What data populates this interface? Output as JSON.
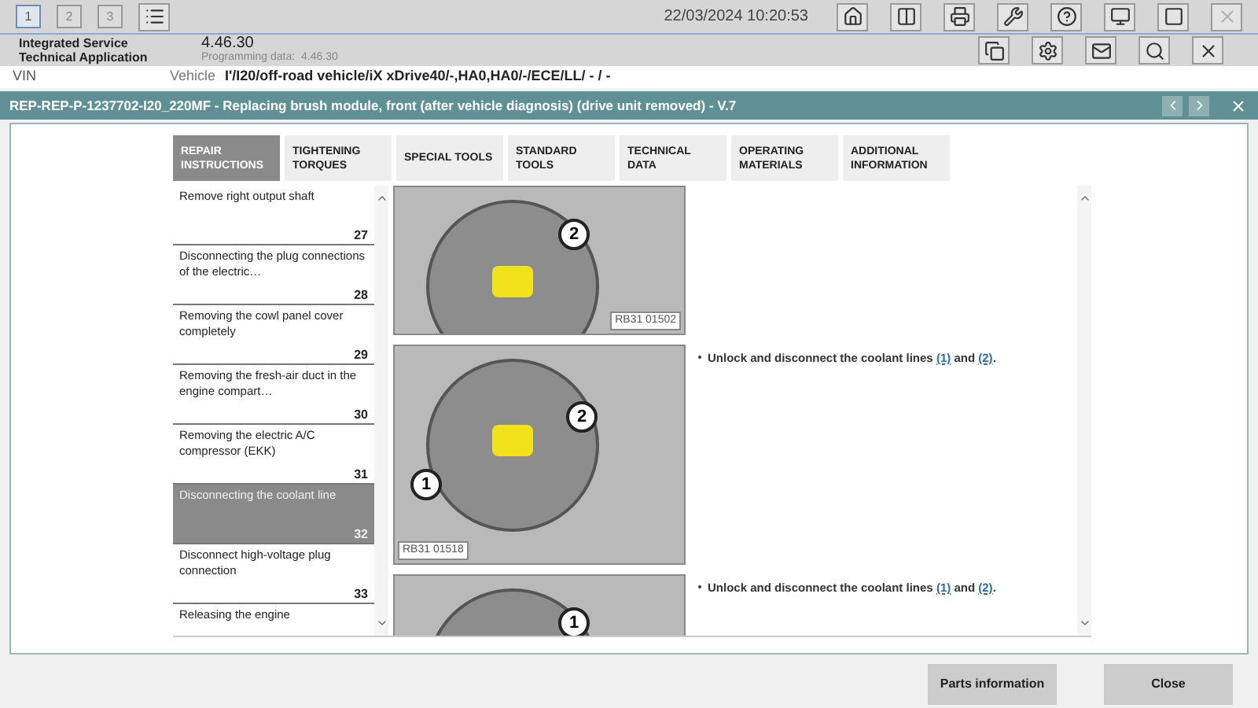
{
  "top_bar": {
    "workspaces": [
      {
        "label": "1",
        "selected": true
      },
      {
        "label": "2",
        "selected": false
      },
      {
        "label": "3",
        "selected": false
      }
    ],
    "datetime": "22/03/2024 10:20:53"
  },
  "app": {
    "name": "Integrated Service Technical Application",
    "version": "4.46.30",
    "programming_label": "Programming data:",
    "programming_value": "4.46.30"
  },
  "vehicle_bar": {
    "vin_label": "VIN",
    "vehicle_label": "Vehicle",
    "vehicle_value": "I'/I20/off-road vehicle/iX xDrive40/-,HA0,HA0/-/ECE/LL/ - / -"
  },
  "document": {
    "title": "REP-REP-P-1237702-I20_220MF - Replacing brush module, front (after vehicle diagnosis) (drive unit removed) - V.7"
  },
  "tabs": [
    {
      "label": "REPAIR INSTRUCTIONS",
      "selected": true
    },
    {
      "label": "TIGHTENING TORQUES",
      "selected": false
    },
    {
      "label": "SPECIAL TOOLS",
      "selected": false
    },
    {
      "label": "STANDARD TOOLS",
      "selected": false
    },
    {
      "label": "TECHNICAL DATA",
      "selected": false
    },
    {
      "label": "OPERATING MATERIALS",
      "selected": false
    },
    {
      "label": "ADDITIONAL INFORMATION",
      "selected": false
    }
  ],
  "steps_list": [
    {
      "title": "Remove right output shaft",
      "number": "27",
      "selected": false
    },
    {
      "title": "Disconnecting the plug connections of the electric…",
      "number": "28",
      "selected": false
    },
    {
      "title": "Removing the cowl panel cover completely",
      "number": "29",
      "selected": false
    },
    {
      "title": "Removing the fresh-air duct in the engine compart…",
      "number": "30",
      "selected": false
    },
    {
      "title": "Removing the electric A/C compressor (EKK)",
      "number": "31",
      "selected": false
    },
    {
      "title": "Disconnecting the coolant line",
      "number": "32",
      "selected": true
    },
    {
      "title": "Disconnect high-voltage plug connection",
      "number": "33",
      "selected": false
    },
    {
      "title": "Releasing the engine",
      "selected": false
    }
  ],
  "figures": [
    {
      "callouts": [
        "2"
      ],
      "code": "RB31 01502"
    },
    {
      "callouts": [
        "1",
        "2"
      ],
      "code": "RB31 01518",
      "segments": [
        {
          "kind": "text",
          "text": "Unlock and disconnect the coolant lines "
        },
        {
          "kind": "link",
          "text": "(1)"
        },
        {
          "kind": "text",
          "text": " and "
        },
        {
          "kind": "link",
          "text": "(2)"
        },
        {
          "kind": "text",
          "text": "."
        }
      ]
    },
    {
      "callouts": [
        "1"
      ],
      "segments": [
        {
          "kind": "text",
          "text": "Unlock and disconnect the coolant lines "
        },
        {
          "kind": "link",
          "text": "(1)"
        },
        {
          "kind": "text",
          "text": " and "
        },
        {
          "kind": "link",
          "text": "(2)"
        },
        {
          "kind": "text",
          "text": "."
        }
      ]
    }
  ],
  "buttons": [
    "Parts information",
    "Close"
  ]
}
